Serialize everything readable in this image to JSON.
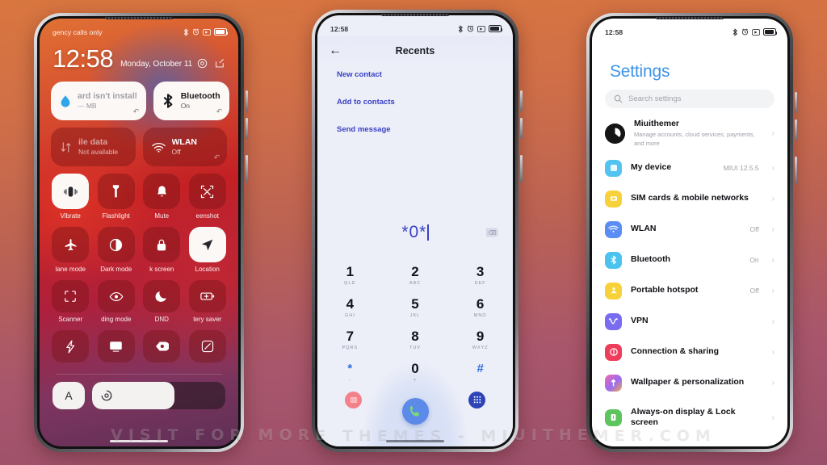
{
  "watermark": "VISIT FOR MORE THEMES - MIUITHEMER.COM",
  "lockscreen": {
    "carrier": "gency calls only",
    "time": "12:58",
    "date": "Monday, October 11",
    "status_time": "",
    "big_tiles": [
      {
        "title": "ard isn't install",
        "sub": "--- MB",
        "icon": "water-drop-icon",
        "state": "on"
      },
      {
        "title": "Bluetooth",
        "sub": "On",
        "icon": "bluetooth-icon",
        "state": "on"
      },
      {
        "title": "ile data",
        "sub": "Not available",
        "icon": "mobile-data-icon",
        "state": "off"
      },
      {
        "title": "WLAN",
        "sub": "Off",
        "icon": "wifi-icon",
        "state": "off"
      }
    ],
    "tiles_row1": [
      {
        "label": "Vibrate",
        "icon": "vibrate-icon",
        "state": "on"
      },
      {
        "label": "Flashlight",
        "icon": "flashlight-icon",
        "state": "off"
      },
      {
        "label": "Mute",
        "icon": "bell-icon",
        "state": "off"
      },
      {
        "label": "eenshot",
        "icon": "screenshot-icon",
        "state": "off"
      }
    ],
    "tiles_row2": [
      {
        "label": "lane mode",
        "icon": "airplane-icon",
        "state": "off"
      },
      {
        "label": "Dark mode",
        "icon": "contrast-icon",
        "state": "off"
      },
      {
        "label": "k screen",
        "icon": "lock-icon",
        "state": "off"
      },
      {
        "label": "Location",
        "icon": "location-arrow-icon",
        "state": "on"
      }
    ],
    "tiles_row3": [
      {
        "label": "Scanner",
        "icon": "scanner-icon",
        "state": "off"
      },
      {
        "label": "ding mode",
        "icon": "eye-icon",
        "state": "off"
      },
      {
        "label": "DND",
        "icon": "moon-icon",
        "state": "off"
      },
      {
        "label": "tery saver",
        "icon": "battery-plus-icon",
        "state": "off"
      }
    ],
    "tiles_row4": [
      {
        "label": "",
        "icon": "lightning-icon",
        "state": "off"
      },
      {
        "label": "",
        "icon": "cast-icon",
        "state": "off"
      },
      {
        "label": "",
        "icon": "reading-tag-icon",
        "state": "off"
      },
      {
        "label": "",
        "icon": "rotate-icon",
        "state": "off"
      }
    ],
    "bottom": {
      "font_button": "A",
      "brightness_icon": "brightness-icon"
    }
  },
  "dialer": {
    "status_time": "12:58",
    "title": "Recents",
    "back_icon": "back-arrow-icon",
    "menu": [
      "New contact",
      "Add to contacts",
      "Send message"
    ],
    "number": "*0*",
    "backspace_icon": "backspace-icon",
    "keys": [
      {
        "digit": "1",
        "sub": "QLD"
      },
      {
        "digit": "2",
        "sub": "ABC"
      },
      {
        "digit": "3",
        "sub": "DEF"
      },
      {
        "digit": "4",
        "sub": "GHI"
      },
      {
        "digit": "5",
        "sub": "JKL"
      },
      {
        "digit": "6",
        "sub": "MNO"
      },
      {
        "digit": "7",
        "sub": "PQRS"
      },
      {
        "digit": "8",
        "sub": "TUV"
      },
      {
        "digit": "9",
        "sub": "WXYZ"
      },
      {
        "digit": "*",
        "sub": ","
      },
      {
        "digit": "0",
        "sub": "+"
      },
      {
        "digit": "#",
        "sub": "."
      }
    ],
    "actions": {
      "left_icon": "recents-list-icon",
      "call_icon": "call-icon",
      "right_icon": "keypad-icon"
    }
  },
  "settings": {
    "status_time": "12:58",
    "title": "Settings",
    "search_placeholder": "Search settings",
    "search_icon": "search-icon",
    "account": {
      "name": "Miuithemer",
      "sub": "Manage accounts, cloud services, payments, and more",
      "icon": "account-avatar-icon",
      "color": "#151515"
    },
    "items": [
      {
        "label": "My device",
        "value": "MIUI 12.5.5",
        "icon": "device-icon",
        "color": "#55c3f2"
      },
      {
        "label": "SIM cards & mobile networks",
        "value": "",
        "icon": "sim-card-icon",
        "color": "#f7d13a"
      },
      {
        "label": "WLAN",
        "value": "Off",
        "icon": "wifi-icon",
        "color": "#5b8ef5"
      },
      {
        "label": "Bluetooth",
        "value": "On",
        "icon": "bluetooth-icon",
        "color": "#4cc3ef"
      },
      {
        "label": "Portable hotspot",
        "value": "Off",
        "icon": "hotspot-icon",
        "color": "#f7d13a"
      },
      {
        "label": "VPN",
        "value": "",
        "icon": "vpn-icon",
        "color": "#7a6cf0"
      },
      {
        "label": "Connection & sharing",
        "value": "",
        "icon": "connection-sharing-icon",
        "color": "#ee3d5a"
      },
      {
        "label": "Wallpaper & personalization",
        "value": "",
        "icon": "wallpaper-icon",
        "color": "#9b6cf0"
      },
      {
        "label": "Always-on display & Lock screen",
        "value": "",
        "icon": "aod-lock-icon",
        "color": "#5ec45e"
      }
    ],
    "chevron": "›"
  },
  "colors": {
    "background_top": "#d9763f",
    "background_bottom": "#9a4f6a",
    "settings_accent": "#3d94e8",
    "dialer_accent": "#3a41c4"
  }
}
